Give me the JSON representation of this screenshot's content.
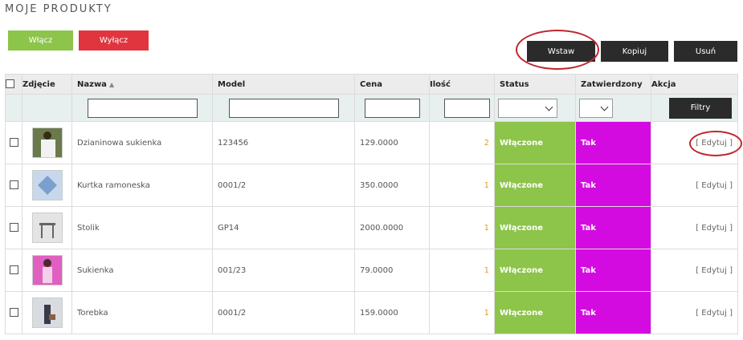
{
  "page": {
    "title": "MOJE PRODUKTY"
  },
  "toolbar": {
    "enable_label": "Włącz",
    "disable_label": "Wyłącz",
    "insert_label": "Wstaw",
    "copy_label": "Kopiuj",
    "delete_label": "Usuń"
  },
  "table": {
    "headers": {
      "photo": "Zdjęcie",
      "name": "Nazwa",
      "model": "Model",
      "price": "Cena",
      "qty": "Ilość",
      "status": "Status",
      "approved": "Zatwierdzony",
      "action": "Akcja"
    },
    "filter_label": "Filtry",
    "rows": [
      {
        "name": "Dzianinowa sukienka",
        "model": "123456",
        "price": "129.0000",
        "qty": "2",
        "status": "Włączone",
        "approved": "Tak",
        "action": "[ Edytuj ]",
        "thumb": "dress-photo"
      },
      {
        "name": "Kurtka ramoneska",
        "model": "0001/2",
        "price": "350.0000",
        "qty": "1",
        "status": "Włączone",
        "approved": "Tak",
        "action": "[ Edytuj ]",
        "thumb": "jacket-photo"
      },
      {
        "name": "Stolik",
        "model": "GP14",
        "price": "2000.0000",
        "qty": "1",
        "status": "Włączone",
        "approved": "Tak",
        "action": "[ Edytuj ]",
        "thumb": "table-photo"
      },
      {
        "name": "Sukienka",
        "model": "001/23",
        "price": "79.0000",
        "qty": "1",
        "status": "Włączone",
        "approved": "Tak",
        "action": "[ Edytuj ]",
        "thumb": "pink-dress-photo"
      },
      {
        "name": "Torebka",
        "model": "0001/2",
        "price": "159.0000",
        "qty": "1",
        "status": "Włączone",
        "approved": "Tak",
        "action": "[ Edytuj ]",
        "thumb": "handbag-photo"
      }
    ]
  },
  "colors": {
    "green": "#8dc44a",
    "red": "#e0353f",
    "magenta": "#d40be0",
    "dark": "#2b2b2b",
    "qty": "#e0a020",
    "highlight": "#c0262e"
  }
}
